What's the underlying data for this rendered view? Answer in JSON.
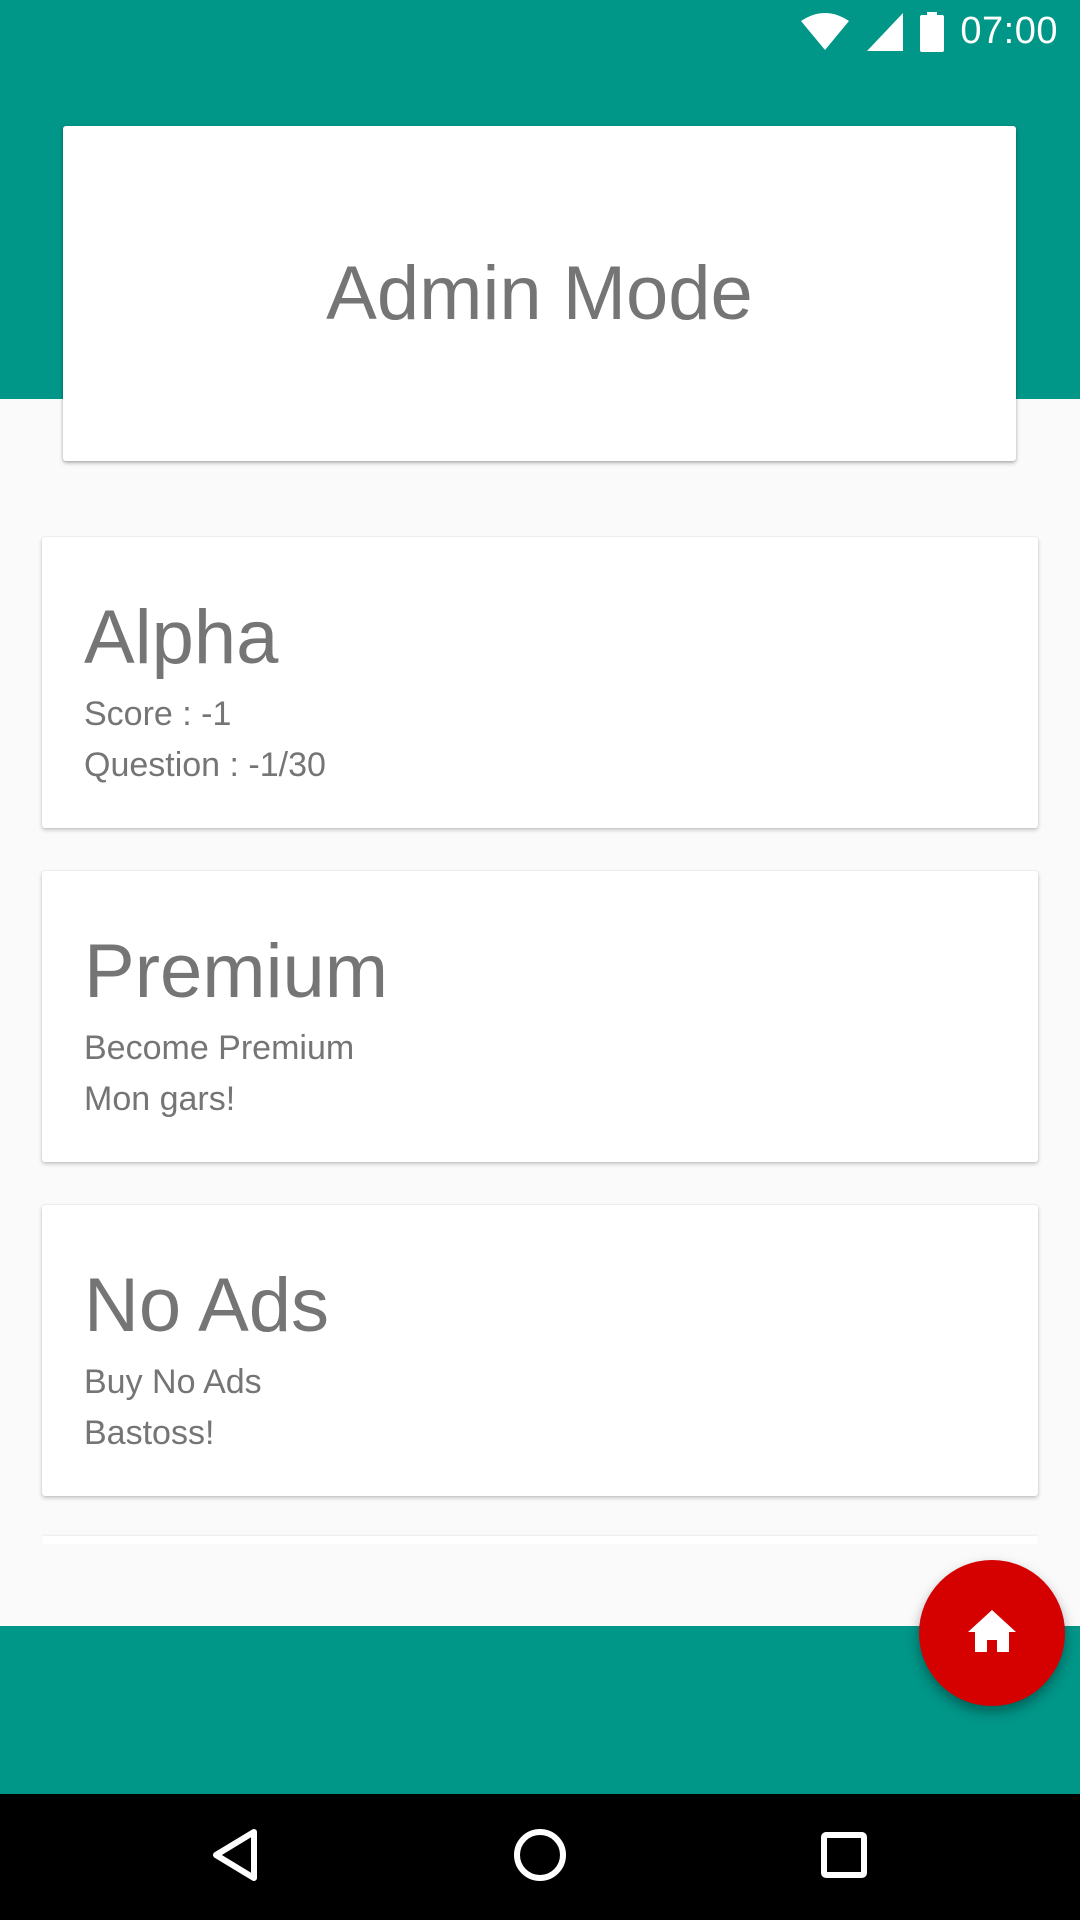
{
  "status_bar": {
    "time": "07:00",
    "icons": [
      "wifi-icon",
      "cell-signal-icon",
      "battery-icon"
    ]
  },
  "header": {
    "title": "Admin Mode"
  },
  "cards": [
    {
      "title": "Alpha",
      "line1": "Score : -1",
      "line2": "Question : -1/30"
    },
    {
      "title": "Premium",
      "line1": "Become Premium",
      "line2": "Mon gars!"
    },
    {
      "title": "No Ads",
      "line1": "Buy No Ads",
      "line2": "Bastoss!"
    }
  ],
  "fab": {
    "icon": "home-icon"
  },
  "nav_bar": {
    "buttons": [
      "back-icon",
      "home-circle-icon",
      "recents-icon"
    ]
  },
  "colors": {
    "primary": "#009688",
    "accent": "#D50000",
    "background": "#FAFAFA",
    "text": "#757575",
    "nav_bar": "#000000"
  }
}
